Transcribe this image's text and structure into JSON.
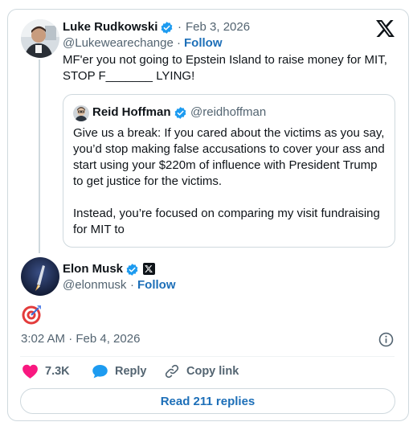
{
  "parent_tweet": {
    "author_name": "Luke Rudkowski",
    "separator": "·",
    "date": "Feb 3, 2026",
    "handle": "@Lukewearechange",
    "follow_label": "Follow",
    "text_line1": "MF'er you not going to Epstein Island to raise money for MIT,",
    "text_line2": "STOP F_______ LYING!"
  },
  "quoted_tweet": {
    "author_name": "Reid Hoffman",
    "handle": "@reidhoffman",
    "lines": [
      "Give us a break: If you cared about the victims as you say,",
      "you’d stop making false accusations to cover your ass and",
      "start using your $220m of influence with President Trump",
      "to get justice for the victims.",
      "",
      "Instead, you’re focused on comparing my visit fundraising",
      "for MIT to"
    ]
  },
  "main_tweet": {
    "author_name": "Elon Musk",
    "handle": "@elonmusk",
    "separator": "·",
    "follow_label": "Follow",
    "emoji": "🎯",
    "timestamp": "3:02 AM · Feb 4, 2026"
  },
  "actions": {
    "like_count": "7.3K",
    "reply_label": "Reply",
    "copy_link_label": "Copy link"
  },
  "read_replies_label": "Read 211 replies",
  "colors": {
    "link_blue": "#1d6fb8",
    "verified_blue": "#1d9bf0",
    "heart_pink": "#f91880",
    "muted_text": "#536471"
  },
  "icons": [
    "x-logo-icon",
    "verified-badge-icon",
    "x-affiliate-badge-icon",
    "info-icon",
    "heart-icon",
    "reply-bubble-icon",
    "link-icon",
    "target-emoji"
  ]
}
